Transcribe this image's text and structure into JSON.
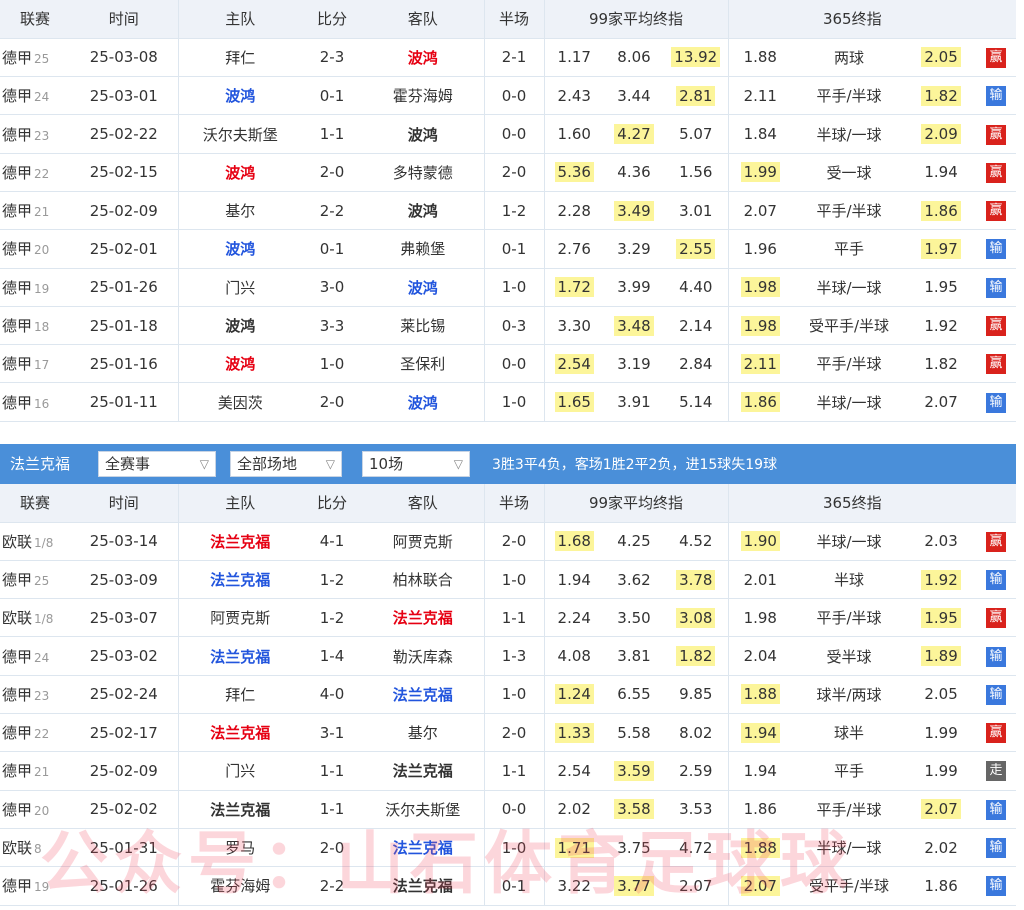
{
  "headers": [
    "联赛",
    "时间",
    "主队",
    "比分",
    "客队",
    "半场",
    "99家平均终指",
    "365终指"
  ],
  "result_labels": {
    "win": "赢",
    "loss": "输",
    "draw": "走"
  },
  "table1": {
    "rows": [
      {
        "league": "德甲",
        "round": "25",
        "date": "25-03-08",
        "home": "拜仁",
        "home_style": "plain",
        "score": "2-3",
        "away": "波鸿",
        "away_style": "red",
        "half": "2-1",
        "a1": "1.17",
        "a2": "8.06",
        "a3": "13.92",
        "ahl": 3,
        "b1": "1.88",
        "bh": "两球",
        "b2": "2.05",
        "bhl": 2,
        "result": "win"
      },
      {
        "league": "德甲",
        "round": "24",
        "date": "25-03-01",
        "home": "波鸿",
        "home_style": "blue",
        "score": "0-1",
        "away": "霍芬海姆",
        "away_style": "plain",
        "half": "0-0",
        "a1": "2.43",
        "a2": "3.44",
        "a3": "2.81",
        "ahl": 3,
        "b1": "2.11",
        "bh": "平手/半球",
        "b2": "1.82",
        "bhl": 2,
        "result": "loss"
      },
      {
        "league": "德甲",
        "round": "23",
        "date": "25-02-22",
        "home": "沃尔夫斯堡",
        "home_style": "plain",
        "score": "1-1",
        "away": "波鸿",
        "away_style": "bold",
        "half": "0-0",
        "a1": "1.60",
        "a2": "4.27",
        "a3": "5.07",
        "ahl": 2,
        "b1": "1.84",
        "bh": "半球/一球",
        "b2": "2.09",
        "bhl": 2,
        "result": "win"
      },
      {
        "league": "德甲",
        "round": "22",
        "date": "25-02-15",
        "home": "波鸿",
        "home_style": "red",
        "score": "2-0",
        "away": "多特蒙德",
        "away_style": "plain",
        "half": "2-0",
        "a1": "5.36",
        "a2": "4.36",
        "a3": "1.56",
        "ahl": 1,
        "b1": "1.99",
        "bh": "受一球",
        "b2": "1.94",
        "bhl": 1,
        "result": "win"
      },
      {
        "league": "德甲",
        "round": "21",
        "date": "25-02-09",
        "home": "基尔",
        "home_style": "plain",
        "score": "2-2",
        "away": "波鸿",
        "away_style": "bold",
        "half": "1-2",
        "a1": "2.28",
        "a2": "3.49",
        "a3": "3.01",
        "ahl": 2,
        "b1": "2.07",
        "bh": "平手/半球",
        "b2": "1.86",
        "bhl": 2,
        "result": "win"
      },
      {
        "league": "德甲",
        "round": "20",
        "date": "25-02-01",
        "home": "波鸿",
        "home_style": "blue",
        "score": "0-1",
        "away": "弗赖堡",
        "away_style": "plain",
        "half": "0-1",
        "a1": "2.76",
        "a2": "3.29",
        "a3": "2.55",
        "ahl": 3,
        "b1": "1.96",
        "bh": "平手",
        "b2": "1.97",
        "bhl": 2,
        "result": "loss"
      },
      {
        "league": "德甲",
        "round": "19",
        "date": "25-01-26",
        "home": "门兴",
        "home_style": "plain",
        "score": "3-0",
        "away": "波鸿",
        "away_style": "blue",
        "half": "1-0",
        "a1": "1.72",
        "a2": "3.99",
        "a3": "4.40",
        "ahl": 1,
        "b1": "1.98",
        "bh": "半球/一球",
        "b2": "1.95",
        "bhl": 1,
        "result": "loss"
      },
      {
        "league": "德甲",
        "round": "18",
        "date": "25-01-18",
        "home": "波鸿",
        "home_style": "bold",
        "score": "3-3",
        "away": "莱比锡",
        "away_style": "plain",
        "half": "0-3",
        "a1": "3.30",
        "a2": "3.48",
        "a3": "2.14",
        "ahl": 2,
        "b1": "1.98",
        "bh": "受平手/半球",
        "b2": "1.92",
        "bhl": 1,
        "result": "win"
      },
      {
        "league": "德甲",
        "round": "17",
        "date": "25-01-16",
        "home": "波鸿",
        "home_style": "red",
        "score": "1-0",
        "away": "圣保利",
        "away_style": "plain",
        "half": "0-0",
        "a1": "2.54",
        "a2": "3.19",
        "a3": "2.84",
        "ahl": 1,
        "b1": "2.11",
        "bh": "平手/半球",
        "b2": "1.82",
        "bhl": 1,
        "result": "win"
      },
      {
        "league": "德甲",
        "round": "16",
        "date": "25-01-11",
        "home": "美因茨",
        "home_style": "plain",
        "score": "2-0",
        "away": "波鸿",
        "away_style": "blue",
        "half": "1-0",
        "a1": "1.65",
        "a2": "3.91",
        "a3": "5.14",
        "ahl": 1,
        "b1": "1.86",
        "bh": "半球/一球",
        "b2": "2.07",
        "bhl": 1,
        "result": "loss"
      }
    ]
  },
  "team2": {
    "name": "法兰克福",
    "filter_competition": "全赛事",
    "filter_venue": "全部场地",
    "filter_count": "10场",
    "summary": "3胜3平4负，客场1胜2平2负，进15球失19球"
  },
  "table2": {
    "rows": [
      {
        "league": "欧联",
        "round": "1/8",
        "date": "25-03-14",
        "home": "法兰克福",
        "home_style": "red",
        "score": "4-1",
        "away": "阿贾克斯",
        "away_style": "plain",
        "half": "2-0",
        "a1": "1.68",
        "a2": "4.25",
        "a3": "4.52",
        "ahl": 1,
        "b1": "1.90",
        "bh": "半球/一球",
        "b2": "2.03",
        "bhl": 1,
        "result": "win"
      },
      {
        "league": "德甲",
        "round": "25",
        "date": "25-03-09",
        "home": "法兰克福",
        "home_style": "blue",
        "score": "1-2",
        "away": "柏林联合",
        "away_style": "plain",
        "half": "1-0",
        "a1": "1.94",
        "a2": "3.62",
        "a3": "3.78",
        "ahl": 3,
        "b1": "2.01",
        "bh": "半球",
        "b2": "1.92",
        "bhl": 2,
        "result": "loss"
      },
      {
        "league": "欧联",
        "round": "1/8",
        "date": "25-03-07",
        "home": "阿贾克斯",
        "home_style": "plain",
        "score": "1-2",
        "away": "法兰克福",
        "away_style": "red",
        "half": "1-1",
        "a1": "2.24",
        "a2": "3.50",
        "a3": "3.08",
        "ahl": 3,
        "b1": "1.98",
        "bh": "平手/半球",
        "b2": "1.95",
        "bhl": 2,
        "result": "win"
      },
      {
        "league": "德甲",
        "round": "24",
        "date": "25-03-02",
        "home": "法兰克福",
        "home_style": "blue",
        "score": "1-4",
        "away": "勒沃库森",
        "away_style": "plain",
        "half": "1-3",
        "a1": "4.08",
        "a2": "3.81",
        "a3": "1.82",
        "ahl": 3,
        "b1": "2.04",
        "bh": "受半球",
        "b2": "1.89",
        "bhl": 2,
        "result": "loss"
      },
      {
        "league": "德甲",
        "round": "23",
        "date": "25-02-24",
        "home": "拜仁",
        "home_style": "plain",
        "score": "4-0",
        "away": "法兰克福",
        "away_style": "blue",
        "half": "1-0",
        "a1": "1.24",
        "a2": "6.55",
        "a3": "9.85",
        "ahl": 1,
        "b1": "1.88",
        "bh": "球半/两球",
        "b2": "2.05",
        "bhl": 1,
        "result": "loss"
      },
      {
        "league": "德甲",
        "round": "22",
        "date": "25-02-17",
        "home": "法兰克福",
        "home_style": "red",
        "score": "3-1",
        "away": "基尔",
        "away_style": "plain",
        "half": "2-0",
        "a1": "1.33",
        "a2": "5.58",
        "a3": "8.02",
        "ahl": 1,
        "b1": "1.94",
        "bh": "球半",
        "b2": "1.99",
        "bhl": 1,
        "result": "win"
      },
      {
        "league": "德甲",
        "round": "21",
        "date": "25-02-09",
        "home": "门兴",
        "home_style": "plain",
        "score": "1-1",
        "away": "法兰克福",
        "away_style": "bold",
        "half": "1-1",
        "a1": "2.54",
        "a2": "3.59",
        "a3": "2.59",
        "ahl": 2,
        "b1": "1.94",
        "bh": "平手",
        "b2": "1.99",
        "bhl": 0,
        "result": "draw"
      },
      {
        "league": "德甲",
        "round": "20",
        "date": "25-02-02",
        "home": "法兰克福",
        "home_style": "bold",
        "score": "1-1",
        "away": "沃尔夫斯堡",
        "away_style": "plain",
        "half": "0-0",
        "a1": "2.02",
        "a2": "3.58",
        "a3": "3.53",
        "ahl": 2,
        "b1": "1.86",
        "bh": "平手/半球",
        "b2": "2.07",
        "bhl": 2,
        "result": "loss"
      },
      {
        "league": "欧联",
        "round": "8",
        "date": "25-01-31",
        "home": "罗马",
        "home_style": "plain",
        "score": "2-0",
        "away": "法兰克福",
        "away_style": "blue",
        "half": "1-0",
        "a1": "1.71",
        "a2": "3.75",
        "a3": "4.72",
        "ahl": 1,
        "b1": "1.88",
        "bh": "半球/一球",
        "b2": "2.02",
        "bhl": 1,
        "result": "loss"
      },
      {
        "league": "德甲",
        "round": "19",
        "date": "25-01-26",
        "home": "霍芬海姆",
        "home_style": "plain",
        "score": "2-2",
        "away": "法兰克福",
        "away_style": "bold",
        "half": "0-1",
        "a1": "3.22",
        "a2": "3.77",
        "a3": "2.07",
        "ahl": 2,
        "b1": "2.07",
        "bh": "受平手/半球",
        "b2": "1.86",
        "bhl": 1,
        "result": "loss"
      }
    ]
  },
  "watermark": "公众号：山石体育足球球",
  "colors": {
    "win": "#d9221c",
    "loss": "#3a78dd",
    "draw": "#666666",
    "highlight": "#fcf59a",
    "header_bar": "#4a8fd9"
  }
}
